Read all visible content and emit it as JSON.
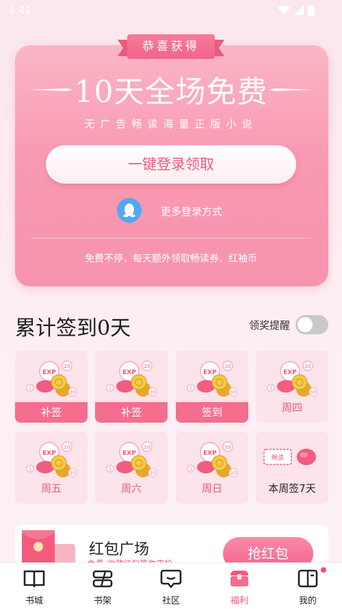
{
  "status_bar": {
    "time": "4:41"
  },
  "hero": {
    "ribbon": "恭喜获得",
    "title": "10天全场免费",
    "subtitle": "无广告畅读海量正版小说",
    "login_button": "一键登录领取",
    "more_login": "更多登录方式",
    "note": "免费不停，每天额外领取畅读券、红袖币"
  },
  "sign_in": {
    "title": "累计签到0天",
    "remind_label": "领奖提醒",
    "remind_on": false,
    "days": [
      {
        "label": "补签",
        "reward_top": "20",
        "reward_side": "20",
        "state": "makeup"
      },
      {
        "label": "补签",
        "reward_top": "20",
        "reward_side": "10",
        "state": "makeup"
      },
      {
        "label": "签到",
        "reward_top": "10",
        "reward_side": "10",
        "state": "today"
      },
      {
        "label": "周四",
        "reward_top": "10",
        "reward_side": "10",
        "state": "future"
      },
      {
        "label": "周五",
        "reward_top": "10",
        "reward_side": "10",
        "state": "future"
      },
      {
        "label": "周六",
        "reward_top": "10",
        "reward_side": "10",
        "state": "future"
      },
      {
        "label": "周日",
        "reward_top": "10",
        "reward_side": "10",
        "state": "future"
      },
      {
        "label": "本周签7天",
        "ticket": "畅读",
        "state": "bonus"
      }
    ],
    "exp_label": "EXP",
    "small_num": "1"
  },
  "red_packet": {
    "title": "红包广场",
    "desc": "免费-收藏红包等你来抢",
    "button": "抢红包"
  },
  "nav": {
    "items": [
      {
        "label": "书城",
        "icon": "book-open-icon"
      },
      {
        "label": "书架",
        "icon": "bookshelf-icon"
      },
      {
        "label": "社区",
        "icon": "chat-bubble-icon"
      },
      {
        "label": "福利",
        "icon": "treasure-chest-icon",
        "active": true
      },
      {
        "label": "我的",
        "icon": "profile-book-icon",
        "badge": true
      }
    ]
  },
  "colors": {
    "accent": "#f0577c",
    "card_bg": "#fde3ea",
    "hero_pink": "#f99ab2"
  }
}
